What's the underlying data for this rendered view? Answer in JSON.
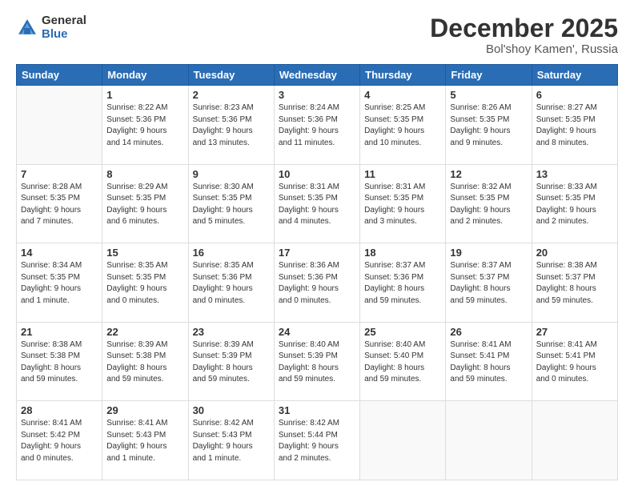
{
  "header": {
    "logo_general": "General",
    "logo_blue": "Blue",
    "month": "December 2025",
    "location": "Bol'shoy Kamen', Russia"
  },
  "weekdays": [
    "Sunday",
    "Monday",
    "Tuesday",
    "Wednesday",
    "Thursday",
    "Friday",
    "Saturday"
  ],
  "weeks": [
    [
      {
        "day": "",
        "info": ""
      },
      {
        "day": "1",
        "info": "Sunrise: 8:22 AM\nSunset: 5:36 PM\nDaylight: 9 hours\nand 14 minutes."
      },
      {
        "day": "2",
        "info": "Sunrise: 8:23 AM\nSunset: 5:36 PM\nDaylight: 9 hours\nand 13 minutes."
      },
      {
        "day": "3",
        "info": "Sunrise: 8:24 AM\nSunset: 5:36 PM\nDaylight: 9 hours\nand 11 minutes."
      },
      {
        "day": "4",
        "info": "Sunrise: 8:25 AM\nSunset: 5:35 PM\nDaylight: 9 hours\nand 10 minutes."
      },
      {
        "day": "5",
        "info": "Sunrise: 8:26 AM\nSunset: 5:35 PM\nDaylight: 9 hours\nand 9 minutes."
      },
      {
        "day": "6",
        "info": "Sunrise: 8:27 AM\nSunset: 5:35 PM\nDaylight: 9 hours\nand 8 minutes."
      }
    ],
    [
      {
        "day": "7",
        "info": "Sunrise: 8:28 AM\nSunset: 5:35 PM\nDaylight: 9 hours\nand 7 minutes."
      },
      {
        "day": "8",
        "info": "Sunrise: 8:29 AM\nSunset: 5:35 PM\nDaylight: 9 hours\nand 6 minutes."
      },
      {
        "day": "9",
        "info": "Sunrise: 8:30 AM\nSunset: 5:35 PM\nDaylight: 9 hours\nand 5 minutes."
      },
      {
        "day": "10",
        "info": "Sunrise: 8:31 AM\nSunset: 5:35 PM\nDaylight: 9 hours\nand 4 minutes."
      },
      {
        "day": "11",
        "info": "Sunrise: 8:31 AM\nSunset: 5:35 PM\nDaylight: 9 hours\nand 3 minutes."
      },
      {
        "day": "12",
        "info": "Sunrise: 8:32 AM\nSunset: 5:35 PM\nDaylight: 9 hours\nand 2 minutes."
      },
      {
        "day": "13",
        "info": "Sunrise: 8:33 AM\nSunset: 5:35 PM\nDaylight: 9 hours\nand 2 minutes."
      }
    ],
    [
      {
        "day": "14",
        "info": "Sunrise: 8:34 AM\nSunset: 5:35 PM\nDaylight: 9 hours\nand 1 minute."
      },
      {
        "day": "15",
        "info": "Sunrise: 8:35 AM\nSunset: 5:35 PM\nDaylight: 9 hours\nand 0 minutes."
      },
      {
        "day": "16",
        "info": "Sunrise: 8:35 AM\nSunset: 5:36 PM\nDaylight: 9 hours\nand 0 minutes."
      },
      {
        "day": "17",
        "info": "Sunrise: 8:36 AM\nSunset: 5:36 PM\nDaylight: 9 hours\nand 0 minutes."
      },
      {
        "day": "18",
        "info": "Sunrise: 8:37 AM\nSunset: 5:36 PM\nDaylight: 8 hours\nand 59 minutes."
      },
      {
        "day": "19",
        "info": "Sunrise: 8:37 AM\nSunset: 5:37 PM\nDaylight: 8 hours\nand 59 minutes."
      },
      {
        "day": "20",
        "info": "Sunrise: 8:38 AM\nSunset: 5:37 PM\nDaylight: 8 hours\nand 59 minutes."
      }
    ],
    [
      {
        "day": "21",
        "info": "Sunrise: 8:38 AM\nSunset: 5:38 PM\nDaylight: 8 hours\nand 59 minutes."
      },
      {
        "day": "22",
        "info": "Sunrise: 8:39 AM\nSunset: 5:38 PM\nDaylight: 8 hours\nand 59 minutes."
      },
      {
        "day": "23",
        "info": "Sunrise: 8:39 AM\nSunset: 5:39 PM\nDaylight: 8 hours\nand 59 minutes."
      },
      {
        "day": "24",
        "info": "Sunrise: 8:40 AM\nSunset: 5:39 PM\nDaylight: 8 hours\nand 59 minutes."
      },
      {
        "day": "25",
        "info": "Sunrise: 8:40 AM\nSunset: 5:40 PM\nDaylight: 8 hours\nand 59 minutes."
      },
      {
        "day": "26",
        "info": "Sunrise: 8:41 AM\nSunset: 5:41 PM\nDaylight: 8 hours\nand 59 minutes."
      },
      {
        "day": "27",
        "info": "Sunrise: 8:41 AM\nSunset: 5:41 PM\nDaylight: 9 hours\nand 0 minutes."
      }
    ],
    [
      {
        "day": "28",
        "info": "Sunrise: 8:41 AM\nSunset: 5:42 PM\nDaylight: 9 hours\nand 0 minutes."
      },
      {
        "day": "29",
        "info": "Sunrise: 8:41 AM\nSunset: 5:43 PM\nDaylight: 9 hours\nand 1 minute."
      },
      {
        "day": "30",
        "info": "Sunrise: 8:42 AM\nSunset: 5:43 PM\nDaylight: 9 hours\nand 1 minute."
      },
      {
        "day": "31",
        "info": "Sunrise: 8:42 AM\nSunset: 5:44 PM\nDaylight: 9 hours\nand 2 minutes."
      },
      {
        "day": "",
        "info": ""
      },
      {
        "day": "",
        "info": ""
      },
      {
        "day": "",
        "info": ""
      }
    ]
  ]
}
